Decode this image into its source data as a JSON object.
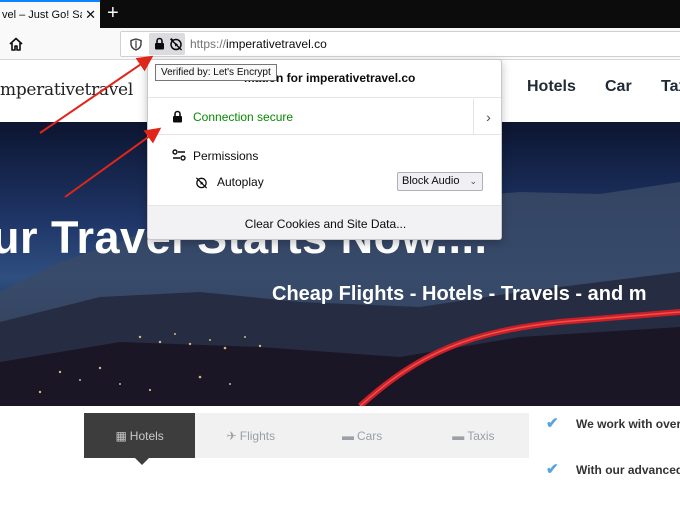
{
  "browser": {
    "tab_title": "vel – Just Go! Safe",
    "tab_close": "✕",
    "new_tab": "+",
    "url_scheme": "https://",
    "url_host": "imperativetravel.co",
    "tooltip": "Verified by: Let's Encrypt"
  },
  "site": {
    "logo": "mperativetravel",
    "nav": [
      "Hotels",
      "Car",
      "Tax"
    ],
    "hero_title": "ur Travel Starts Now....",
    "hero_subtitle": "Cheap Flights - Hotels - Travels - and m",
    "search_tabs": [
      {
        "icon": "hotel-icon",
        "label": "Hotels",
        "active": true
      },
      {
        "icon": "plane-icon",
        "label": "Flights",
        "active": false
      },
      {
        "icon": "car-icon",
        "label": "Cars",
        "active": false
      },
      {
        "icon": "taxi-icon",
        "label": "Taxis",
        "active": false
      }
    ],
    "features": [
      "We work with over h",
      "With our advanced"
    ]
  },
  "panel": {
    "title": "mation for imperativetravel.co",
    "connection": "Connection secure",
    "permissions_label": "Permissions",
    "autoplay_label": "Autoplay",
    "autoplay_value": "Block Audio",
    "footer_button": "Clear Cookies and Site Data..."
  },
  "colors": {
    "secure_green": "#058b00",
    "annotation_red": "#e0261b",
    "tab_accent": "#0a84ff",
    "check_blue": "#56a3e0"
  }
}
